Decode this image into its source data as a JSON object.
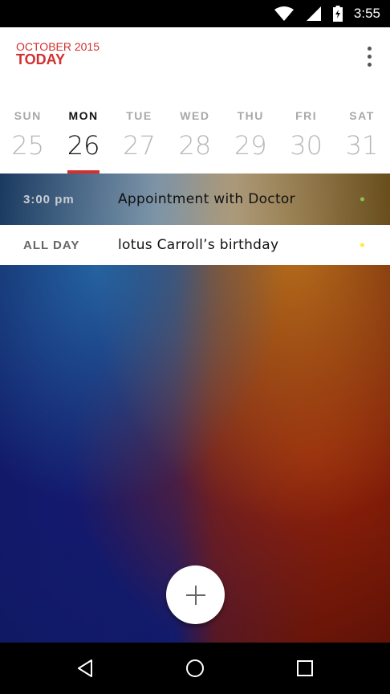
{
  "status_bar": {
    "time": "3:55",
    "icons": [
      "wifi-icon",
      "signal-icon",
      "battery-charging-icon"
    ]
  },
  "header": {
    "month": "OCTOBER 2015",
    "today": "TODAY",
    "menu_icon": "more-vert-icon"
  },
  "week": {
    "days": [
      {
        "name": "SUN",
        "num": "25",
        "selected": false
      },
      {
        "name": "MON",
        "num": "26",
        "selected": true
      },
      {
        "name": "TUE",
        "num": "27",
        "selected": false
      },
      {
        "name": "WED",
        "num": "28",
        "selected": false
      },
      {
        "name": "THU",
        "num": "29",
        "selected": false
      },
      {
        "name": "FRI",
        "num": "30",
        "selected": false
      },
      {
        "name": "SAT",
        "num": "31",
        "selected": false
      }
    ]
  },
  "events": [
    {
      "time": "3:00 pm",
      "title": "Appointment with Doctor",
      "dot_color": "#8bc34a"
    },
    {
      "time": "ALL DAY",
      "title": "lotus Carroll’s birthday",
      "dot_color": "#ffeb3b"
    }
  ],
  "fab": {
    "icon": "plus-icon"
  },
  "nav_bar": {
    "icons": [
      "back-icon",
      "home-icon",
      "recents-icon"
    ]
  },
  "colors": {
    "accent": "#d32f2f"
  }
}
